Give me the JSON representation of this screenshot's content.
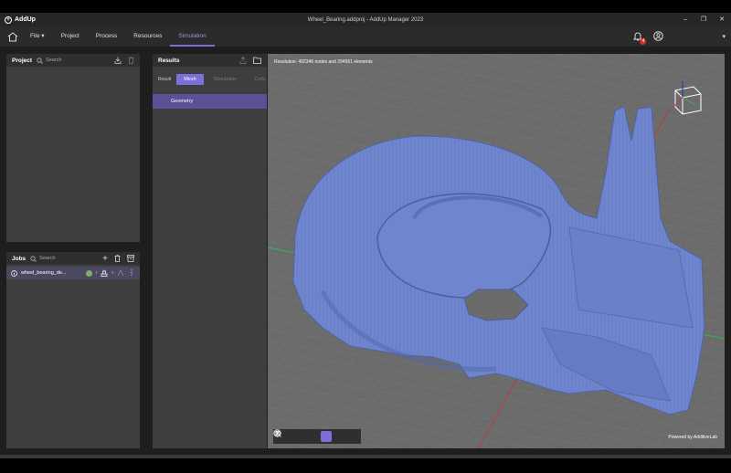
{
  "app": {
    "logo_text": "AddUp",
    "window_title": "Wheel_Bearing.addproj - AddUp Manager 2023"
  },
  "menu": {
    "items": [
      "File",
      "Project",
      "Process",
      "Resources",
      "Simulation"
    ],
    "active": "Simulation",
    "notifications_count": "4"
  },
  "project_panel": {
    "title": "Project",
    "search_placeholder": "Search"
  },
  "jobs_panel": {
    "title": "Jobs",
    "search_placeholder": "Search",
    "job_name": "wheel_bearing_de..."
  },
  "results_panel": {
    "title": "Results",
    "result_label": "Result",
    "tabs": [
      "Mesh",
      "Simulation",
      "Cells"
    ],
    "selected_tab": "Mesh",
    "selected_item": "Geometry"
  },
  "viewport": {
    "resolution_text": "Resolution: 492346 nodes and 294561 elements",
    "powered_by": "Powered by AdditiveLab",
    "model_color": "#6f86cf",
    "background_color": "#6b6b6b",
    "axis_x_color": "#c23b3b",
    "axis_y_color": "#39b54a"
  },
  "colors": {
    "accent": "#7a70d8"
  }
}
